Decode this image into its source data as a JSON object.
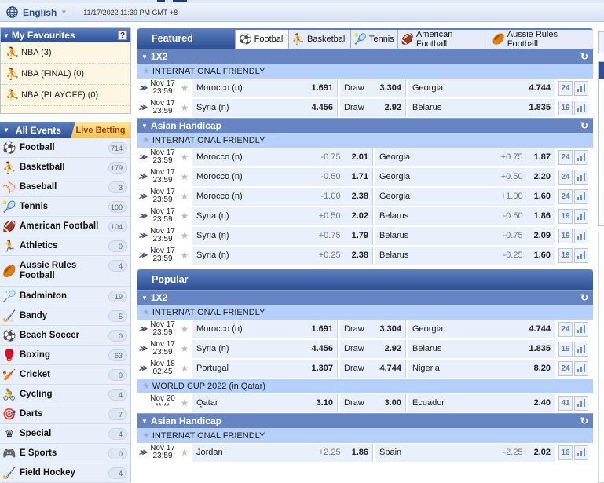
{
  "header": {
    "language": "English",
    "datetime": "11/17/2022 11:39 PM GMT +8"
  },
  "favourites": {
    "title": "My Favourites",
    "help": "?",
    "items": [
      {
        "label": "NBA (3)",
        "icon": "basketball-player-icon"
      },
      {
        "label": "NBA (FINAL) (0)",
        "icon": "basketball-player-icon"
      },
      {
        "label": "NBA (PLAYOFF) (0)",
        "icon": "basketball-player-icon"
      }
    ]
  },
  "events": {
    "tab_all": "All Events",
    "tab_live": "Live Betting",
    "sports": [
      {
        "name": "Football",
        "count": "714",
        "icon": "⚽"
      },
      {
        "name": "Basketball",
        "count": "179",
        "icon": "⛹"
      },
      {
        "name": "Baseball",
        "count": "3",
        "icon": "⚾"
      },
      {
        "name": "Tennis",
        "count": "100",
        "icon": "🎾"
      },
      {
        "name": "American Football",
        "count": "104",
        "icon": "🏈"
      },
      {
        "name": "Athletics",
        "count": "0",
        "icon": "🏃"
      },
      {
        "name": "Aussie Rules Football",
        "count": "4",
        "icon": "🏉"
      },
      {
        "name": "Badminton",
        "count": "19",
        "icon": "🏸"
      },
      {
        "name": "Bandy",
        "count": "5",
        "icon": "🏑"
      },
      {
        "name": "Beach Soccer",
        "count": "0",
        "icon": "⚽"
      },
      {
        "name": "Boxing",
        "count": "63",
        "icon": "🥊"
      },
      {
        "name": "Cricket",
        "count": "0",
        "icon": "🏏"
      },
      {
        "name": "Cycling",
        "count": "4",
        "icon": "🚴"
      },
      {
        "name": "Darts",
        "count": "7",
        "icon": "🎯"
      },
      {
        "name": "Special",
        "count": "4",
        "icon": "♛"
      },
      {
        "name": "E Sports",
        "count": "0",
        "icon": "🎮"
      },
      {
        "name": "Field Hockey",
        "count": "4",
        "icon": "🏑"
      }
    ]
  },
  "featured": {
    "title": "Featured",
    "tabs": [
      {
        "label": "Football",
        "icon": "⚽",
        "active": true
      },
      {
        "label": "Basketball",
        "icon": "⛹"
      },
      {
        "label": "Tennis",
        "icon": "🎾"
      },
      {
        "label": "American Football",
        "icon": "🏈"
      },
      {
        "label": "Aussie Rules Football",
        "icon": "🏉"
      }
    ],
    "markets": [
      {
        "title": "1X2",
        "type": "1x2",
        "leagues": [
          {
            "name": "INTERNATIONAL FRIENDLY",
            "rows": [
              {
                "date": "Nov 17",
                "time": "23:59",
                "home": "Morocco (n)",
                "home_odds": "1.691",
                "draw": "Draw",
                "draw_odds": "3.304",
                "away": "Georgia",
                "away_odds": "4.744",
                "more": "24",
                "live": true
              },
              {
                "date": "Nov 17",
                "time": "23:59",
                "home": "Syria (n)",
                "home_odds": "4.456",
                "draw": "Draw",
                "draw_odds": "2.92",
                "away": "Belarus",
                "away_odds": "1.835",
                "more": "19",
                "live": true
              }
            ]
          }
        ]
      },
      {
        "title": "Asian Handicap",
        "type": "ah",
        "leagues": [
          {
            "name": "INTERNATIONAL FRIENDLY",
            "rows": [
              {
                "date": "Nov 17",
                "time": "23:59",
                "home": "Morocco (n)",
                "home_hcp": "-0.75",
                "home_odds": "2.01",
                "away": "Georgia",
                "away_hcp": "+0.75",
                "away_odds": "1.87",
                "more": "24",
                "live": true
              },
              {
                "date": "Nov 17",
                "time": "23:59",
                "home": "Morocco (n)",
                "home_hcp": "-0.50",
                "home_odds": "1.71",
                "away": "Georgia",
                "away_hcp": "+0.50",
                "away_odds": "2.20",
                "more": "24",
                "live": true
              },
              {
                "date": "Nov 17",
                "time": "23:59",
                "home": "Morocco (n)",
                "home_hcp": "-1.00",
                "home_odds": "2.38",
                "away": "Georgia",
                "away_hcp": "+1.00",
                "away_odds": "1.60",
                "more": "24",
                "live": true
              },
              {
                "date": "Nov 17",
                "time": "23:59",
                "home": "Syria (n)",
                "home_hcp": "+0.50",
                "home_odds": "2.02",
                "away": "Belarus",
                "away_hcp": "-0.50",
                "away_odds": "1.86",
                "more": "19",
                "live": true
              },
              {
                "date": "Nov 17",
                "time": "23:59",
                "home": "Syria (n)",
                "home_hcp": "+0.75",
                "home_odds": "1.79",
                "away": "Belarus",
                "away_hcp": "-0.75",
                "away_odds": "2.09",
                "more": "19",
                "live": true
              },
              {
                "date": "Nov 17",
                "time": "23:59",
                "home": "Syria (n)",
                "home_hcp": "+0.25",
                "home_odds": "2.38",
                "away": "Belarus",
                "away_hcp": "-0.25",
                "away_odds": "1.60",
                "more": "19",
                "live": true
              }
            ]
          }
        ]
      }
    ]
  },
  "popular": {
    "title": "Popular",
    "markets": [
      {
        "title": "1X2",
        "type": "1x2",
        "leagues": [
          {
            "name": "INTERNATIONAL FRIENDLY",
            "rows": [
              {
                "date": "Nov 17",
                "time": "23:59",
                "home": "Morocco (n)",
                "home_odds": "1.691",
                "draw": "Draw",
                "draw_odds": "3.304",
                "away": "Georgia",
                "away_odds": "4.744",
                "more": "24",
                "live": true
              },
              {
                "date": "Nov 17",
                "time": "23:59",
                "home": "Syria (n)",
                "home_odds": "4.456",
                "draw": "Draw",
                "draw_odds": "2.92",
                "away": "Belarus",
                "away_odds": "1.835",
                "more": "19",
                "live": true
              },
              {
                "date": "Nov 18",
                "time": "02:45",
                "home": "Portugal",
                "home_odds": "1.307",
                "draw": "Draw",
                "draw_odds": "4.744",
                "away": "Nigeria",
                "away_odds": "8.20",
                "more": "24",
                "live": true
              }
            ]
          },
          {
            "name": "WORLD CUP 2022 (in Qatar)",
            "rows": [
              {
                "date": "Nov 20",
                "time": "**:**",
                "home": "Qatar",
                "home_odds": "3.10",
                "draw": "Draw",
                "draw_odds": "3.00",
                "away": "Ecuador",
                "away_odds": "2.40",
                "more": "41",
                "live": false
              }
            ]
          }
        ]
      },
      {
        "title": "Asian Handicap",
        "type": "ah",
        "leagues": [
          {
            "name": "INTERNATIONAL FRIENDLY",
            "rows": [
              {
                "date": "Nov 17",
                "time": "23:59",
                "home": "Jordan",
                "home_hcp": "+2.25",
                "home_odds": "1.86",
                "away": "Spain",
                "away_hcp": "-2.25",
                "away_odds": "2.02",
                "more": "16",
                "live": true
              }
            ]
          }
        ]
      }
    ]
  }
}
